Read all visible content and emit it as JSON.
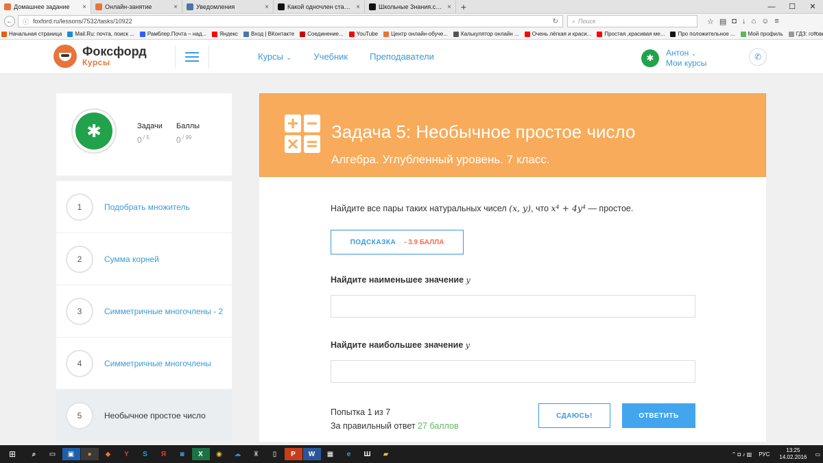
{
  "browser": {
    "tabs": [
      {
        "label": "Домашнее задание",
        "fav": "#e8743b",
        "active": true
      },
      {
        "label": "Онлайн-занятие",
        "fav": "#e8743b",
        "active": false
      },
      {
        "label": "Уведомления",
        "fav": "#4a76a8",
        "active": false
      },
      {
        "label": "Какой одночлен стандар...",
        "fav": "#111111",
        "active": false
      },
      {
        "label": "Школьные Знания.com -...",
        "fav": "#111111",
        "active": false
      }
    ],
    "new_tab": "+",
    "url": "foxford.ru/lessons/7532/tasks/10922",
    "search_placeholder": "Поиск",
    "bookmarks": [
      {
        "label": "Начальная страница",
        "color": "#e66000"
      },
      {
        "label": "Mail.Ru: почта, поиск ...",
        "color": "#168de2"
      },
      {
        "label": "Рамблер.Почта – над...",
        "color": "#315efb"
      },
      {
        "label": "Яндекс",
        "color": "#ff0000"
      },
      {
        "label": "Вход | ВКонтакте",
        "color": "#4a76a8"
      },
      {
        "label": "Соединение...",
        "color": "#cc0000"
      },
      {
        "label": "YouTube",
        "color": "#ff0000"
      },
      {
        "label": "Центр онлайн-обуче...",
        "color": "#e8743b"
      },
      {
        "label": "Калькулятор онлайн ...",
        "color": "#555555"
      },
      {
        "label": "Очень лёгкая и краси...",
        "color": "#ff0000"
      },
      {
        "label": "Простая ,красивая ме...",
        "color": "#ff0000"
      },
      {
        "label": "Про положительное ...",
        "color": "#111111"
      },
      {
        "label": "Мой профиль",
        "color": "#5cb85c"
      },
      {
        "label": "ГДЗ: готовые домаш...",
        "color": "#999999"
      }
    ]
  },
  "header": {
    "logo_title": "Фоксфорд",
    "logo_sub": "Курсы",
    "nav": {
      "courses": "Курсы",
      "textbook": "Учебник",
      "teachers": "Преподаватели"
    },
    "user_name": "Антон",
    "user_courses": "Мои курсы"
  },
  "stats": {
    "tasks_label": "Задачи",
    "tasks_value": "0",
    "tasks_total": "5",
    "points_label": "Баллы",
    "points_value": "0",
    "points_total": "99"
  },
  "tasks": [
    {
      "num": "1",
      "title": "Подобрать множитель"
    },
    {
      "num": "2",
      "title": "Сумма корней"
    },
    {
      "num": "3",
      "title": "Симметричные многочлены - 2"
    },
    {
      "num": "4",
      "title": "Симметричные многочлены"
    },
    {
      "num": "5",
      "title": "Необычное простое число"
    }
  ],
  "problem": {
    "title": "Задача 5: Необычное простое число",
    "subtitle": "Алгебра. Углубленный уровень. 7 класс.",
    "text_before": "Найдите все пары таких натуральных чисел ",
    "pair": "(x, y)",
    "text_mid": ", что ",
    "formula": "x⁴ + 4y⁴",
    "text_after": " — простое.",
    "hint_label": "ПОДСКАЗКА",
    "hint_cost": "- 3.9 БАЛЛА",
    "q1_label": "Найдите наименьшее значение ",
    "q1_var": "y",
    "q2_label": "Найдите наибольшее значение ",
    "q2_var": "y",
    "attempt": "Попытка 1 из 7",
    "reward_text": "За правильный ответ ",
    "reward_points": "27 баллов",
    "giveup": "СДАЮСЬ!",
    "submit": "ОТВЕТИТЬ"
  },
  "taskbar": {
    "lang": "РУС",
    "time": "13:25",
    "date": "14.02.2016"
  },
  "colors": {
    "accent": "#3a9ad9",
    "banner": "#f8ab5a",
    "avatar": "#22a24a",
    "hint_cost": "#f26c4f",
    "reward": "#5cb85c",
    "submit": "#42a5ed"
  }
}
